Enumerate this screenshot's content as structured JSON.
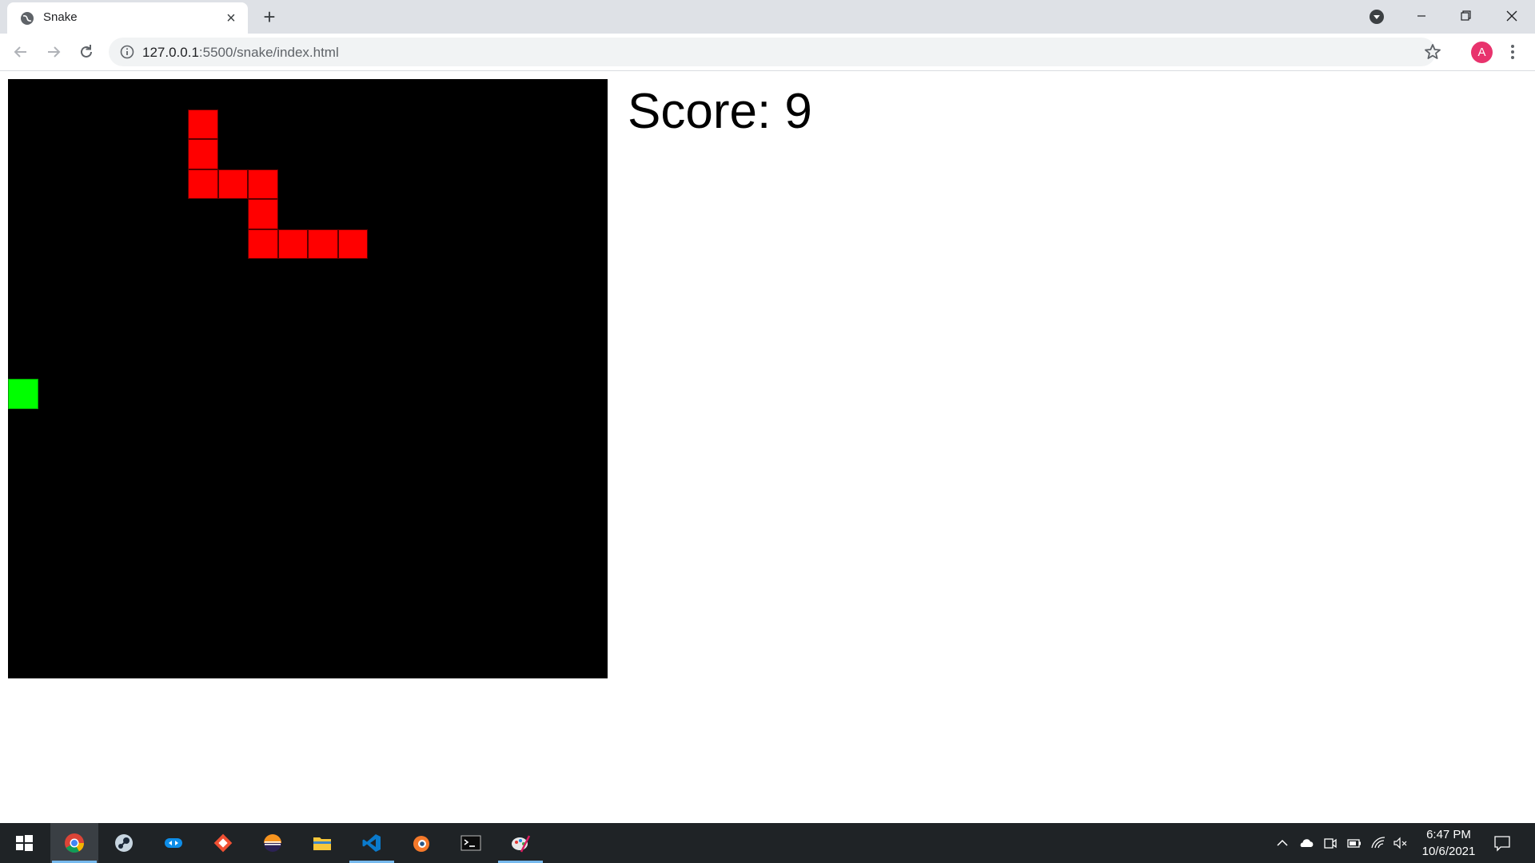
{
  "browser": {
    "tab_title": "Snake",
    "url_host": "127.0.0.1",
    "url_path": ":5500/snake/index.html",
    "profile_initial": "A"
  },
  "game": {
    "score_label": "Score: 9",
    "score": 9,
    "grid_cols": 20,
    "grid_rows": 20,
    "background_color": "#000000",
    "snake_color": "#ff0000",
    "food_color": "#00ff00",
    "snake": [
      [
        6,
        1
      ],
      [
        6,
        2
      ],
      [
        6,
        3
      ],
      [
        7,
        3
      ],
      [
        8,
        3
      ],
      [
        8,
        4
      ],
      [
        8,
        5
      ],
      [
        9,
        5
      ],
      [
        10,
        5
      ],
      [
        11,
        5
      ]
    ],
    "food": [
      0,
      10
    ]
  },
  "taskbar": {
    "apps": [
      "windows-start-icon",
      "chrome-icon",
      "steam-icon",
      "teamviewer-icon",
      "git-icon",
      "eclipse-icon",
      "file-explorer-icon",
      "vscode-icon",
      "blender-icon",
      "terminal-icon",
      "paint-icon"
    ],
    "time": "6:47 PM",
    "date": "10/6/2021"
  }
}
